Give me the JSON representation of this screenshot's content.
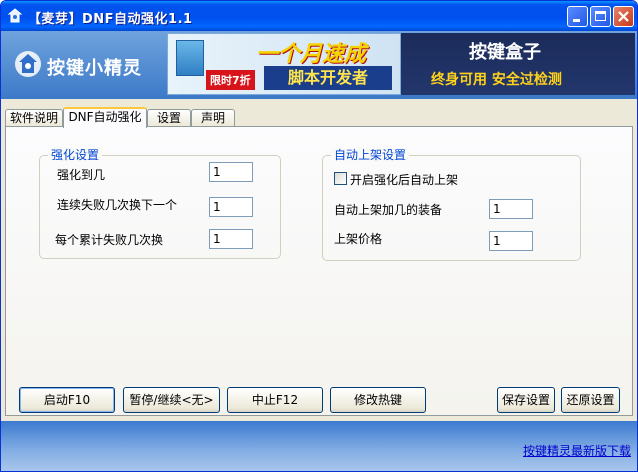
{
  "window": {
    "title": "【麦芽】DNF自动强化1.1"
  },
  "header": {
    "logo_text": "按键小精灵",
    "banner_left": {
      "headline": "一个月速成",
      "subline": "脚本开发者",
      "badge": "限时7折"
    },
    "banner_right": {
      "title": "按键盒子",
      "slogan": "终身可用  安全过检测"
    }
  },
  "tabs": [
    {
      "label": "软件说明",
      "active": false
    },
    {
      "label": "DNF自动强化",
      "active": true
    },
    {
      "label": "设置",
      "active": false
    },
    {
      "label": "声明",
      "active": false
    }
  ],
  "enhance_group": {
    "title": "强化设置",
    "fields": [
      {
        "label": "强化到几",
        "value": "1"
      },
      {
        "label": "连续失败几次换下一个",
        "value": "1"
      },
      {
        "label": "每个累计失败几次换",
        "value": "1"
      }
    ]
  },
  "listing_group": {
    "title": "自动上架设置",
    "checkbox_label": "开启强化后自动上架",
    "checkbox_checked": false,
    "fields": [
      {
        "label": "自动上架加几的装备",
        "value": "1"
      },
      {
        "label": "上架价格",
        "value": "1"
      }
    ]
  },
  "buttons": {
    "start": "启动F10",
    "pause": "暂停/继续<无>",
    "stop": "中止F12",
    "hotkey": "修改热键",
    "save": "保存设置",
    "restore": "还原设置"
  },
  "footer": {
    "link": "按键精灵最新版下载"
  },
  "colors": {
    "titlebar": "#0054e3",
    "group_title": "#0046d5",
    "footer_link": "#0000cc"
  }
}
